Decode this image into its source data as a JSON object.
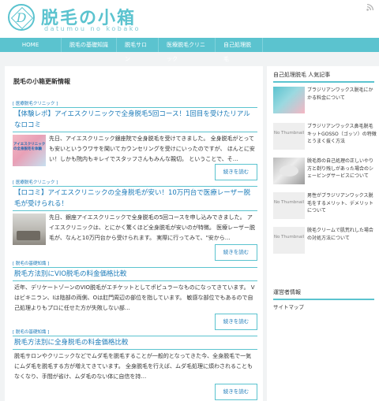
{
  "header": {
    "logo_letter": "D",
    "site_title": "脱毛の小箱",
    "site_subtitle": "datumou no kobako",
    "rss_icon": "rss-icon"
  },
  "nav": {
    "items": [
      "HOME",
      "脱毛の基礎知識",
      "脱毛サロン",
      "医療脱毛クリニック",
      "自己処理脱毛"
    ]
  },
  "main": {
    "title": "脱毛の小箱更新情報",
    "read_more_label": "続きを読む",
    "articles": [
      {
        "category": "[ 医療脱毛クリニック ]",
        "title": "【体験レポ】アイエスクリニックで全身脱毛5回コース！1回目を受けたリアルなロコミ",
        "thumb_text": "アイエスクリニックの全身脱毛を体験",
        "excerpt": "先日、アイエスクリニック銀座院で全身脱毛を受けてきました。 全身脱毛がとっても安いというウワサを聞いてカウンセリングを受けにいったのですが、 ほんとに安い！しかも院内もキレイでスタッフさんもみんな親切。 ということで、そ…"
      },
      {
        "category": "[ 医療脱毛クリニック ]",
        "title": "【ロコミ】アイエスクリニックの全身脱毛が安い！10万円台で医療レーザー脱毛が受けられる！",
        "thumb_text": "",
        "excerpt": "先日、銀座アイエスクリニックで全身脱毛の5回コースを申し込みできました。 アイエスクリニックは、とにかく驚くほど全身脱毛が安いのが特徴。 医療レーザー脱毛が、なんと10万円台から受けられます。 実際に行ってみて、\"安から…"
      },
      {
        "category": "[ 脱毛の基礎知識 ]",
        "title": "脱毛方法別にVIO脱毛の料金価格比較",
        "excerpt": "近年、デリケートゾーンのVIO脱毛がエチケットとしてポピュラーなものになってきています。 Vはビキニラン、Iは陰部の両側、Oは肛門周辺の部位を指しています。 敏感な部位でもあるので自己処理よりもプロに任せた方が失敗しない部…"
      },
      {
        "category": "[ 脱毛の基礎知識 ]",
        "title": "脱毛方法別に全身脱毛の料金価格比較",
        "excerpt": "脱毛サロンやクリニックなどでムダ毛を脱毛することが一般的となってきた今、全身脱毛で一気にムダ毛を脱毛する方が増えてきています。 全身脱毛を行えば、ムダ毛処理に煩わされることもなくなり、手間が省け、ムダ毛のない体に自信を持…"
      }
    ]
  },
  "sidebar": {
    "popular_heading": "自己処理脱毛 人気記事",
    "no_thumb_label": "No Thumbnail",
    "popular": [
      "ブラジリアンワックス脱毛にかかる料金について",
      "ブラジリアンワックス鼻毛脱毛キットGOSSO（ゴッソ）の特徴とうまく抜く方法",
      "脱毛券の自己処理の正しいやり方と剃り残しがあった場合のシェービングサービスについて",
      "男性がブラジリアンワックス脱毛をするメリット、デメリットについて",
      "脱毛クリームで肌荒れした場合の対処方法について"
    ],
    "operator_heading": "運営者情報",
    "sitemap_label": "サイトマップ"
  }
}
